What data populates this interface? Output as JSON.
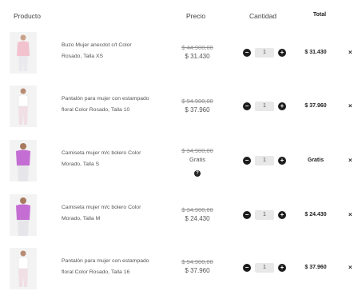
{
  "header": {
    "producto": "Producto",
    "precio": "Precio",
    "cantidad": "Cantidad",
    "total": "Total"
  },
  "items": [
    {
      "name_line1": "Buzo Mujer anecdot c/t Color",
      "name_line2": "Rosado, Talla XS",
      "old_price": "$ 44.900,00",
      "price": "$ 31.430",
      "qty": "1",
      "total": "$ 31.430",
      "garment_color": "#f2c2cf"
    },
    {
      "name_line1": "Pantalón para mujer con estampado",
      "name_line2": "floral Color Rosado, Talla 10",
      "old_price": "$ 94.900,00",
      "price": "$ 37.960",
      "qty": "1",
      "total": "$ 37.960",
      "garment_color": "#f0dfe4"
    },
    {
      "name_line1": "Camiseta mujer m/c bolero Color",
      "name_line2": "Morado, Talla S",
      "old_price": "$ 34.900,00",
      "price": "Gratis",
      "qty": "1",
      "total": "Gratis",
      "garment_color": "#c46ed3"
    },
    {
      "name_line1": "Camiseta mujer m/c bolero Color",
      "name_line2": "Morado, Talla M",
      "old_price": "$ 34.900,00",
      "price": "$ 24.430",
      "qty": "1",
      "total": "$ 24.430",
      "garment_color": "#c46ed3"
    },
    {
      "name_line1": "Pantalón para mujer con estampado",
      "name_line2": "floral Color Rosado, Talla 16",
      "old_price": "$ 94.900,00",
      "price": "$ 37.960",
      "qty": "1",
      "total": "$ 37.960",
      "garment_color": "#f0dfe4"
    }
  ],
  "icons": {
    "minus": "−",
    "plus": "+",
    "help": "?",
    "remove": "×"
  }
}
